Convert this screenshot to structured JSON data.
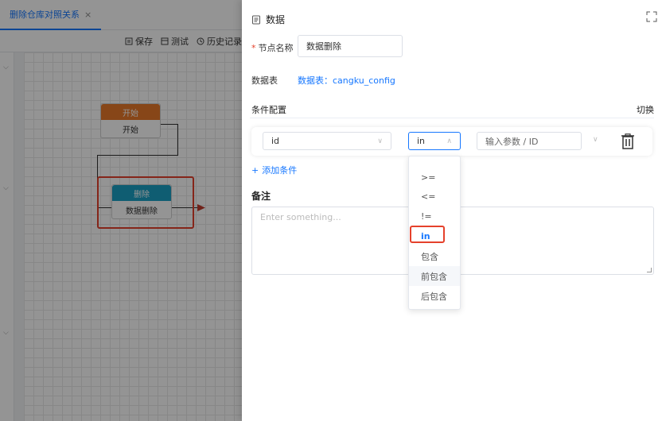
{
  "tab": {
    "title": "删除仓库对照关系",
    "close": "×"
  },
  "toolbar": {
    "save": "保存",
    "test": "测试",
    "history": "历史记录"
  },
  "canvas": {
    "start_node": {
      "head": "开始",
      "body": "开始"
    },
    "delete_node": {
      "head": "删除",
      "body": "数据删除"
    }
  },
  "drawer": {
    "title": "数据",
    "node_name": {
      "required": "*",
      "label": "节点名称",
      "value": "数据删除"
    },
    "table": {
      "label": "数据表",
      "value": "数据表：cangku_config"
    },
    "conditions": {
      "label": "条件配置",
      "toggle": "切换"
    },
    "condition_row": {
      "field": "id",
      "operator": "in",
      "param_placeholder": "输入参数 / ID"
    },
    "add_condition": "添加条件",
    "remark": {
      "label": "备注",
      "placeholder": "Enter something..."
    },
    "operator_options": [
      ">=",
      "<=",
      "!=",
      "in",
      "包含",
      "前包含",
      "后包含"
    ],
    "selected_operator": "in"
  }
}
